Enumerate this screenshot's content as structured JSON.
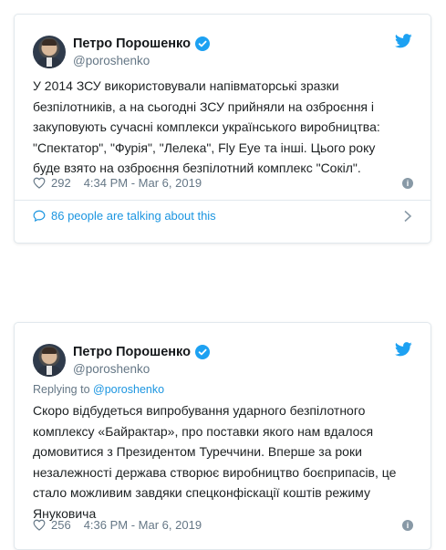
{
  "tweets": [
    {
      "author": "Петро Порошенко",
      "handle": "@poroshenko",
      "text": "У 2014 ЗСУ використовували напівматорські зразки\nбезпілотників, а на сьогодні ЗСУ прийняли на озброєння і\nзакуповують сучасні комплекси українського виробництва:\n\"Спектатор\", \"Фурія\", \"Лелека\", Fly Eye та інші. Цього року\nбуде взято на озброєння безпілотний комплекс \"Сокіл\".",
      "likes": "292",
      "timestamp": "4:34 PM - Mar 6, 2019",
      "talking": "86 people are talking about this"
    },
    {
      "author": "Петро Порошенко",
      "handle": "@poroshenko",
      "reply_prefix": "Replying to",
      "reply_to": "@poroshenko",
      "text": "Скоро відбудеться випробування ударного безпілотного\nкомплексу «Байрактар», про поставки якого нам вдалося\nдомовитися з Президентом Туреччини. Вперше за роки\nнезалежності держава створює виробництво боєприпасів, це\nстало можливим завдяки спецконфіскації коштів режиму\nЯнуковича",
      "likes": "256",
      "timestamp": "4:36 PM - Mar 6, 2019"
    }
  ],
  "icons": {
    "verified": "verified-badge-icon",
    "twitter": "twitter-bird-icon",
    "like": "heart-icon",
    "info": "info-icon",
    "comment": "speech-bubble-icon",
    "more": "chevron-right-icon"
  },
  "colors": {
    "twitter_blue": "#1da1f2",
    "link_blue": "#1b95e0",
    "muted": "#657786",
    "border": "#e1e8ed"
  }
}
